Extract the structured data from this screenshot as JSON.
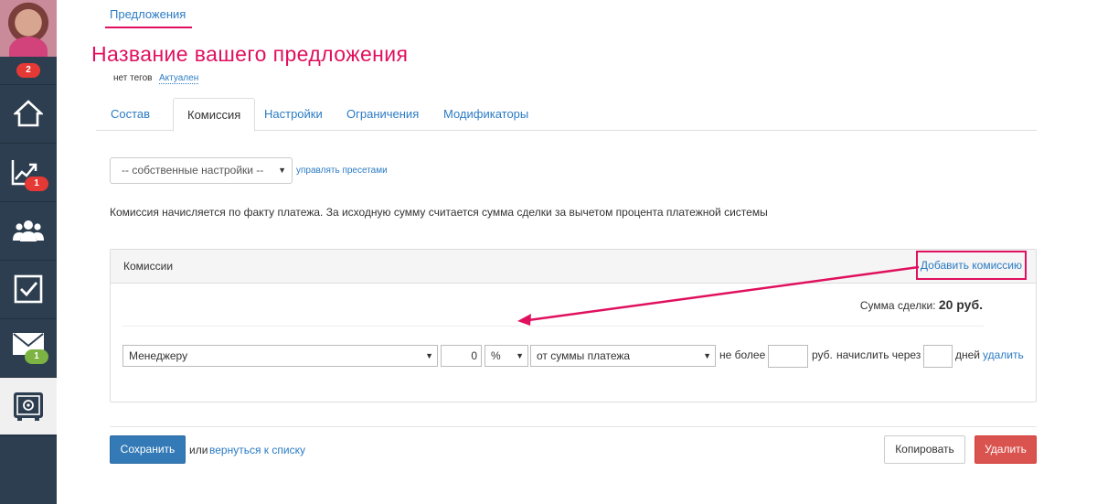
{
  "sidebar": {
    "avatar_badge": "2",
    "items": [
      {
        "name": "home",
        "icon": "home-icon",
        "badge": ""
      },
      {
        "name": "stats",
        "icon": "chart-icon",
        "badge": "1"
      },
      {
        "name": "users",
        "icon": "users-icon",
        "badge": ""
      },
      {
        "name": "tasks",
        "icon": "checkbox-icon",
        "badge": ""
      },
      {
        "name": "mail",
        "icon": "mail-icon",
        "badge": "1"
      },
      {
        "name": "safe",
        "icon": "safe-icon",
        "badge": ""
      }
    ]
  },
  "breadcrumb": {
    "label": "Предложения"
  },
  "page": {
    "title": "Название вашего предложения",
    "tags": "нет тегов",
    "status": "Актуален"
  },
  "tabs": [
    {
      "label": "Состав",
      "active": false
    },
    {
      "label": "Комиссия",
      "active": true
    },
    {
      "label": "Настройки",
      "active": false
    },
    {
      "label": "Ограничения",
      "active": false
    },
    {
      "label": "Модификаторы",
      "active": false
    }
  ],
  "preset": {
    "selected": "-- собственные настройки --",
    "manage_label": "управлять пресетами"
  },
  "note": "Комиссия начисляется по факту платежа. За исходную сумму считается сумма сделки за вычетом процента платежной системы",
  "commissions": {
    "title": "Комиссии",
    "add_label": "Добавить комиссию",
    "sum_label": "Сумма сделки:",
    "sum_value": "20 руб.",
    "row": {
      "recipient": "Менеджеру",
      "amount": "0",
      "unit": "%",
      "base": "от суммы платежа",
      "max_label": "не более",
      "max_value": "",
      "currency_label": "руб.",
      "delay_label": "начислить через",
      "delay_value": "",
      "days_label": "дней",
      "delete_label": "удалить"
    }
  },
  "footer": {
    "save_label": "Сохранить",
    "or_label": "или",
    "back_label": "вернуться к списку",
    "copy_label": "Копировать",
    "delete_label": "Удалить"
  },
  "colors": {
    "accent": "#e0105e",
    "link": "#2b7bc4",
    "primary": "#337ab7",
    "danger": "#d9534f",
    "sidebar": "#2d3e50"
  }
}
